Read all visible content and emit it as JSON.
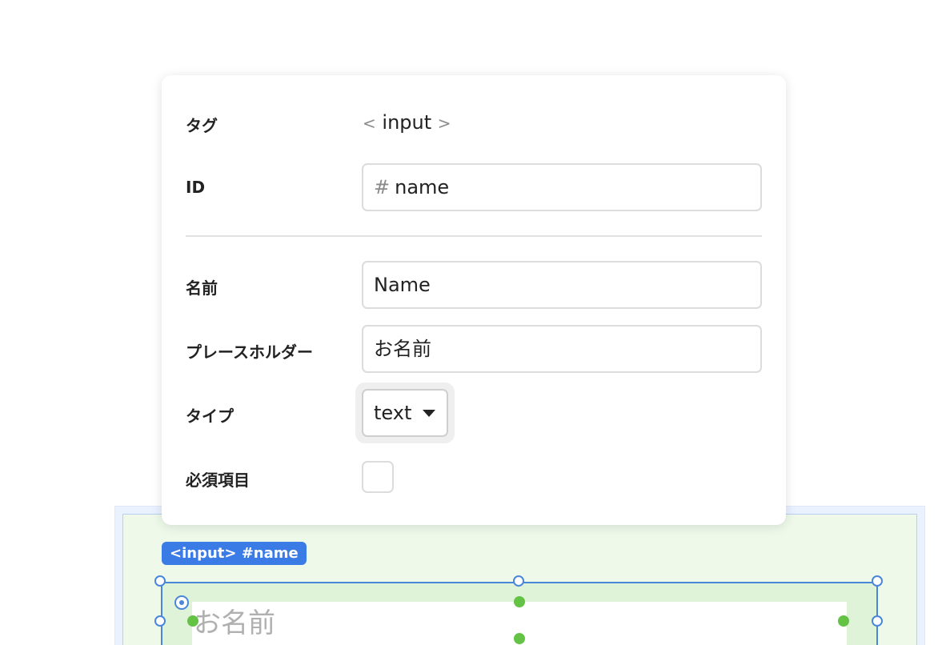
{
  "panel": {
    "tag": {
      "label": "タグ",
      "open_bracket": "<",
      "value": "input",
      "close_bracket": ">"
    },
    "id": {
      "label": "ID",
      "prefix": "#",
      "value": "name"
    },
    "name": {
      "label": "名前",
      "value": "Name"
    },
    "placeholder": {
      "label": "プレースホルダー",
      "value": "お名前"
    },
    "type": {
      "label": "タイプ",
      "selected": "text"
    },
    "required": {
      "label": "必須項目",
      "checked": false
    }
  },
  "canvas": {
    "badge": "<input> #name",
    "element_placeholder": "お名前"
  },
  "colors": {
    "accent": "#3b7be6",
    "selection_border": "#4a86d9",
    "element_fill": "#dff3d8",
    "handle_green": "#64c244"
  }
}
